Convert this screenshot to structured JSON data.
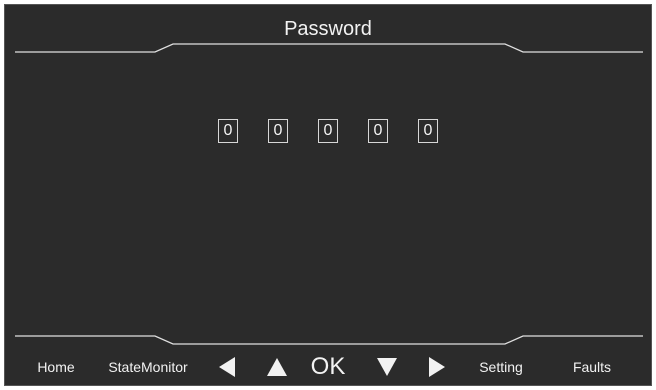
{
  "header": {
    "title": "Password"
  },
  "password": {
    "digits": [
      "0",
      "0",
      "0",
      "0",
      "0"
    ]
  },
  "footer": {
    "home": "Home",
    "state_monitor": "StateMonitor",
    "ok": "OK",
    "setting": "Setting",
    "faults": "Faults",
    "left_icon": "triangle-left-icon",
    "up_icon": "triangle-up-icon",
    "down_icon": "triangle-down-icon",
    "right_icon": "triangle-right-icon"
  },
  "colors": {
    "background": "#2b2b2b",
    "text": "#f2f2f2",
    "lines": "#e0e0e0"
  }
}
